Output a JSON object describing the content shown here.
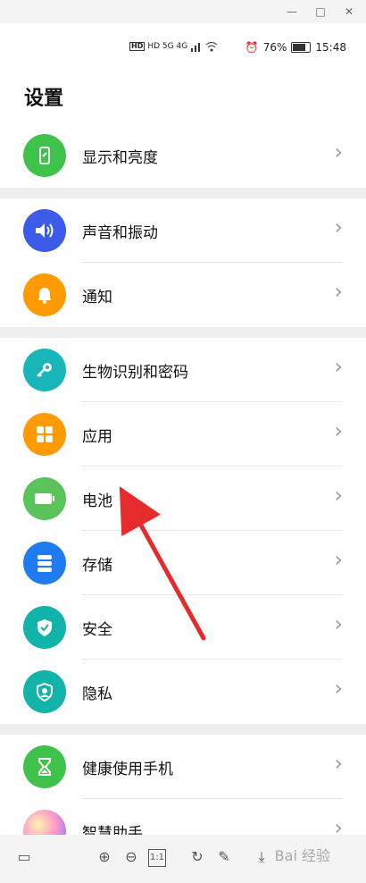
{
  "window": {
    "min_glyph": "—",
    "max_glyph": "□",
    "close_glyph": "✕"
  },
  "status": {
    "network_left": "HD 5G 4G",
    "battery_pct": "76%",
    "time": "15:48",
    "battery_level": 0.76
  },
  "page": {
    "title": "设置"
  },
  "items": [
    {
      "label": "显示和亮度",
      "icon": "display-icon",
      "color": "#3ec24a"
    },
    {
      "label": "声音和振动",
      "icon": "sound-icon",
      "color": "#3b5be8"
    },
    {
      "label": "通知",
      "icon": "bell-icon",
      "color": "#ff9a00"
    },
    {
      "label": "生物识别和密码",
      "icon": "key-icon",
      "color": "#18b6b9"
    },
    {
      "label": "应用",
      "icon": "apps-icon",
      "color": "#ff9a00"
    },
    {
      "label": "电池",
      "icon": "battery-icon",
      "color": "#3ec24a"
    },
    {
      "label": "存储",
      "icon": "storage-icon",
      "color": "#1f7cf0"
    },
    {
      "label": "安全",
      "icon": "shield-icon",
      "color": "#12b3a8"
    },
    {
      "label": "隐私",
      "icon": "privacy-icon",
      "color": "#12b3a8"
    },
    {
      "label": "健康使用手机",
      "icon": "hourglass-icon",
      "color": "#3ec24a"
    },
    {
      "label": "智慧助手",
      "icon": "assistant-icon",
      "color": "#c88bff"
    }
  ],
  "toolbar": {
    "one_to_one": "1:1"
  },
  "watermark": {
    "text": "Bai 经验"
  }
}
